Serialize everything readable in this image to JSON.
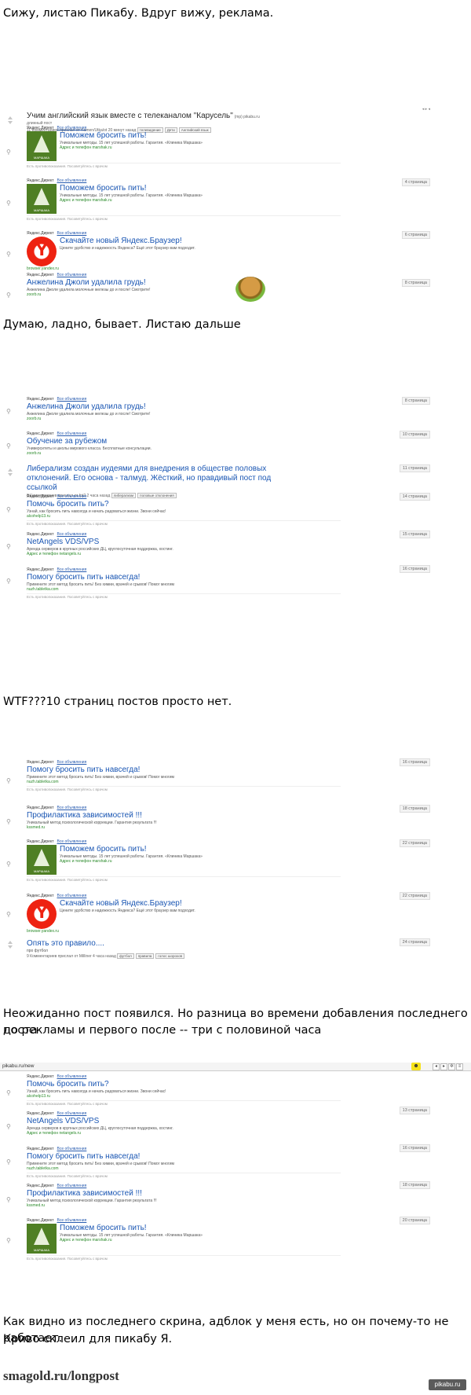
{
  "captions": [
    "Сижу, листаю Пикабу. Вдруг вижу, реклама.",
    "Думаю, ладно, бывает. Листаю дальше",
    "WTF???10 страниц постов просто нет.",
    "Неожиданно пост появился. Но разница во времени добавления последнего поста",
    "до рекламы и первого после -- три с половиной часа",
    "Как видно из последнего скрина, адблок у меня есть, но он почему-то не работает.",
    "Криво склеил для пикабу Я."
  ],
  "common": {
    "ad_header": "Яндекс.Директ",
    "ad_all": "Все объявления",
    "ad_footer": "Есть противопоказания. Посоветуйтесь с врачом",
    "ad_footer_short": "Есть противопоказания. Посоветуйтесь с врачом"
  },
  "shot1": {
    "post_title": "Учим английский язык вместе с телеканалом \"Карусель\"",
    "post_domain": "(mp) pikabu.ru",
    "post_sub": "длинный пост",
    "post_meta": "11 Комментариев прислал от Kamen/Utka/ot 20 минут назад",
    "tags": [
      "телевидение",
      "Дети",
      "Английский язык"
    ],
    "ads": [
      {
        "title": "Поможем бросить пить!",
        "text": "Уникальные методы. 15 лет успешной работы. Гарантия. «Клиника Маршака»",
        "url": "Адрес и телефон  marshak.ru",
        "logo": "МАРШАКА",
        "badge": ""
      },
      {
        "title": "Поможем бросить пить!",
        "text": "Уникальные методы. 15 лет успешной работы. Гарантия. «Клиника Маршака»",
        "url": "Адрес и телефон  marshak.ru",
        "logo": "МАРШАКА",
        "badge": "4 страница"
      },
      {
        "title": "Скачайте новый Яндекс.Браузер!",
        "text": "Цените удобство и надежность Яндекса? Ещё этот браузер вам подходит.",
        "url": "browser.yandex.ru",
        "logo": "",
        "badge": "6 страница"
      },
      {
        "title": "Анжелина Джоли удалила грудь!",
        "text": "Анжелина Джоли удалила молочные железы до и после! Смотрите!",
        "url": "zoorb.ru",
        "logo": "",
        "badge": "8 страница"
      }
    ]
  },
  "shot2": {
    "items": [
      {
        "title": "Анжелина Джоли удалила грудь!",
        "text": "Анжелина Джоли удалила молочные железы до и после! Смотрите!",
        "url": "zoorb.ru",
        "badge": "8 страница",
        "kind": "ad"
      },
      {
        "title": "Обучение за рубежом",
        "text": "Университеты и школы мирового класса. Бесплатные консультации.",
        "url": "zoorb.ru",
        "badge": "10 страница",
        "kind": "ad"
      },
      {
        "title": "Либерализм создан иудеями для внедрения в обществе половых отклонений. Его основа - талмуд. Жёсткий, но правдивый пост под ссылкой",
        "text": "8 Комментариев прислал от fpt2 2 часа назад",
        "url": "",
        "badge": "11 страница",
        "kind": "post",
        "tags": [
          "либерализм",
          "половые отклонения"
        ]
      },
      {
        "title": "Помочь бросить пить?",
        "text": "Узнай, как бросить пить навсегда и начать радоваться жизни. Звони сейчас!",
        "url": "alcohelp13.ru",
        "badge": "14 страница",
        "kind": "ad"
      },
      {
        "title": "NetAngels VDS/VPS",
        "text": "Аренда серверов в крупных российских ДЦ, круглосуточная поддержка, хостинг.",
        "url": "Адрес и телефон  netangels.ru",
        "badge": "15 страница",
        "kind": "ad"
      },
      {
        "title": "Помогу бросить пить навсегда!",
        "text": "Примените этот метод бросить пить! Без химии, врачей и срывов! Помог многим",
        "url": "nuzh.tabletka.com",
        "badge": "16 страница",
        "kind": "ad"
      }
    ]
  },
  "shot3": {
    "items": [
      {
        "title": "Помогу бросить пить навсегда!",
        "text": "Примените этот метод бросить пить! Без химии, врачей и срывов! Помог многим",
        "url": "nuzh.tabletka.com",
        "badge": "16 страница",
        "kind": "ad",
        "logo": ""
      },
      {
        "title": "Профилактика зависимостей !!!",
        "text": "Уникальный метод психологической коррекции. Гарантия результата !!!",
        "url": "kssmed.ru",
        "badge": "18 страница",
        "kind": "ad",
        "logo": ""
      },
      {
        "title": "Поможем бросить пить!",
        "text": "Уникальные методы. 15 лет успешной работы. Гарантия. «Клиника Маршака»",
        "url": "Адрес и телефон  marshak.ru",
        "badge": "22 страница",
        "kind": "ad",
        "logo": "МАРШАКА"
      },
      {
        "title": "Скачайте новый Яндекс.Браузер!",
        "text": "Цените удобство и надежность Яндекса? Ещё этот браузер вам подходит.",
        "url": "browser.yandex.ru",
        "badge": "22 страница",
        "kind": "ad",
        "logo": "ya"
      },
      {
        "title": "Опять это правило....",
        "text": "про футбол",
        "url": "",
        "badge": "24 страница",
        "kind": "post",
        "logo": "",
        "meta": "9 Комментариев прислал от Milliner 4 часа назад",
        "tags": [
          "футбол",
          "правила",
          "голос шорохов"
        ]
      }
    ]
  },
  "shot4": {
    "address": "pikabu.ru/new",
    "items": [
      {
        "title": "Помочь бросить пить?",
        "text": "Узнай, как бросить пить навсегда и начать радоваться жизни. Звони сейчас!",
        "url": "alcohelp13.ru",
        "badge": "",
        "logo": ""
      },
      {
        "title": "NetAngels VDS/VPS",
        "text": "Аренда серверов в крупных российских ДЦ, круглосуточная поддержка, хостинг.",
        "url": "Адрес и телефон  netangels.ru",
        "badge": "13 страница",
        "logo": ""
      },
      {
        "title": "Помогу бросить пить навсегда!",
        "text": "Примените этот метод бросить пить! Без химии, врачей и срывов! Помог многим",
        "url": "nuzh.tabletka.com",
        "badge": "16 страница",
        "logo": ""
      },
      {
        "title": "Профилактика зависимостей !!!",
        "text": "Уникальный метод психологической коррекции. Гарантия результата !!!",
        "url": "kssmed.ru",
        "badge": "18 страница",
        "logo": ""
      },
      {
        "title": "Поможем бросить пить!",
        "text": "Уникальные методы. 15 лет успешной работы. Гарантия. «Клиника Маршака»",
        "url": "Адрес и телефон  marshak.ru",
        "badge": "20 страница",
        "logo": "МАРШАКА"
      }
    ]
  },
  "footer": {
    "source": "smagold.ru/longpost",
    "watermark": "pikabu.ru"
  }
}
